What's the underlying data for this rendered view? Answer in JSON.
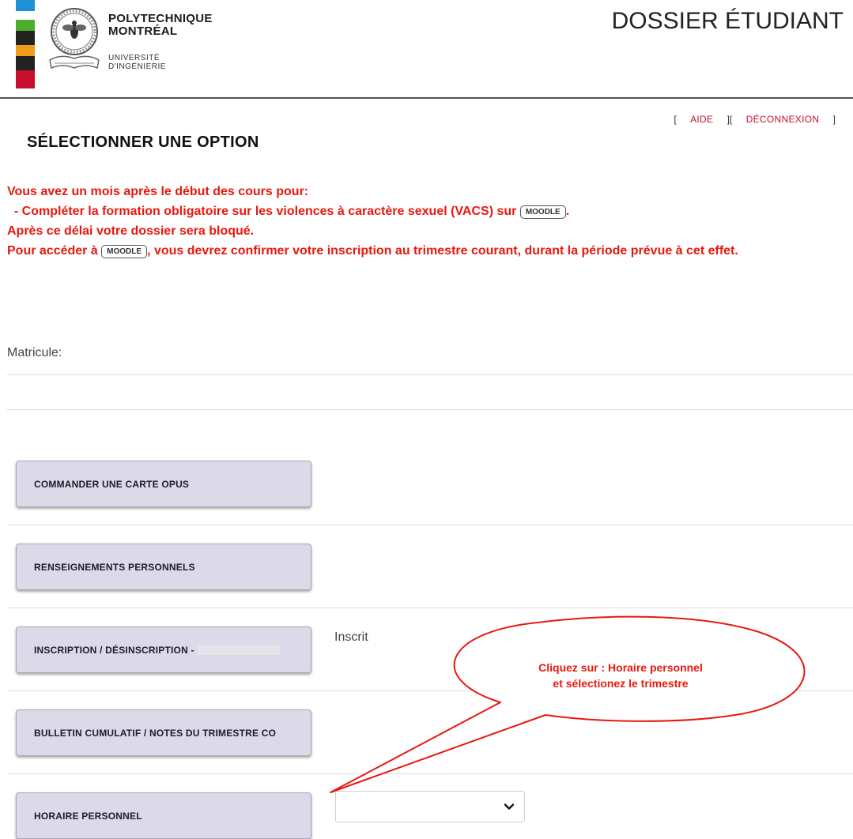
{
  "brand": {
    "name_line1": "POLYTECHNIQUE",
    "name_line2": "MONTRÉAL",
    "sub_line1": "UNIVERSITÉ",
    "sub_line2": "D'INGÉNIERIE",
    "bar_colors": [
      "#1e90d6",
      "#ffffff",
      "#4caf2a",
      "#222222",
      "#f29d1a",
      "#222222",
      "#c8102e"
    ],
    "logo_icon": "polytechnique-seal-icon"
  },
  "header": {
    "title": "DOSSIER ÉTUDIANT"
  },
  "toplinks": {
    "open": "[",
    "sep": "][",
    "close": "]",
    "help": "AIDE",
    "logout": "DÉCONNEXION"
  },
  "page": {
    "title": "SÉLECTIONNER UNE OPTION"
  },
  "notice": {
    "line1": "Vous avez un mois après le début des cours pour:",
    "line2_before": " - Compléter la formation obligatoire sur les violences à caractère sexuel (VACS) sur ",
    "line2_after": ".",
    "line3": "Après ce délai votre dossier sera bloqué.",
    "line4_before": "Pour accéder à ",
    "line4_after": ", vous devrez confirmer votre inscription au trimestre courant, durant la période prévue à cet effet.",
    "moodle_label": "MOODLE",
    "color": "#e8180e"
  },
  "student": {
    "matricule_label": "Matricule:"
  },
  "options": [
    {
      "label": "COMMANDER UNE CARTE OPUS"
    },
    {
      "label": "RENSEIGNEMENTS PERSONNELS"
    },
    {
      "label": "INSCRIPTION / DÉSINSCRIPTION -",
      "status": "Inscrit"
    },
    {
      "label": "BULLETIN CUMULATIF / NOTES DU TRIMESTRE CO"
    },
    {
      "label": "HORAIRE PERSONNEL"
    }
  ],
  "term_select": {
    "selected": "",
    "icon": "chevron-down-icon"
  },
  "callout": {
    "line1": "Cliquez sur : Horaire personnel",
    "line2": "et sélectionez le trimestre",
    "color": "#e8180e"
  }
}
